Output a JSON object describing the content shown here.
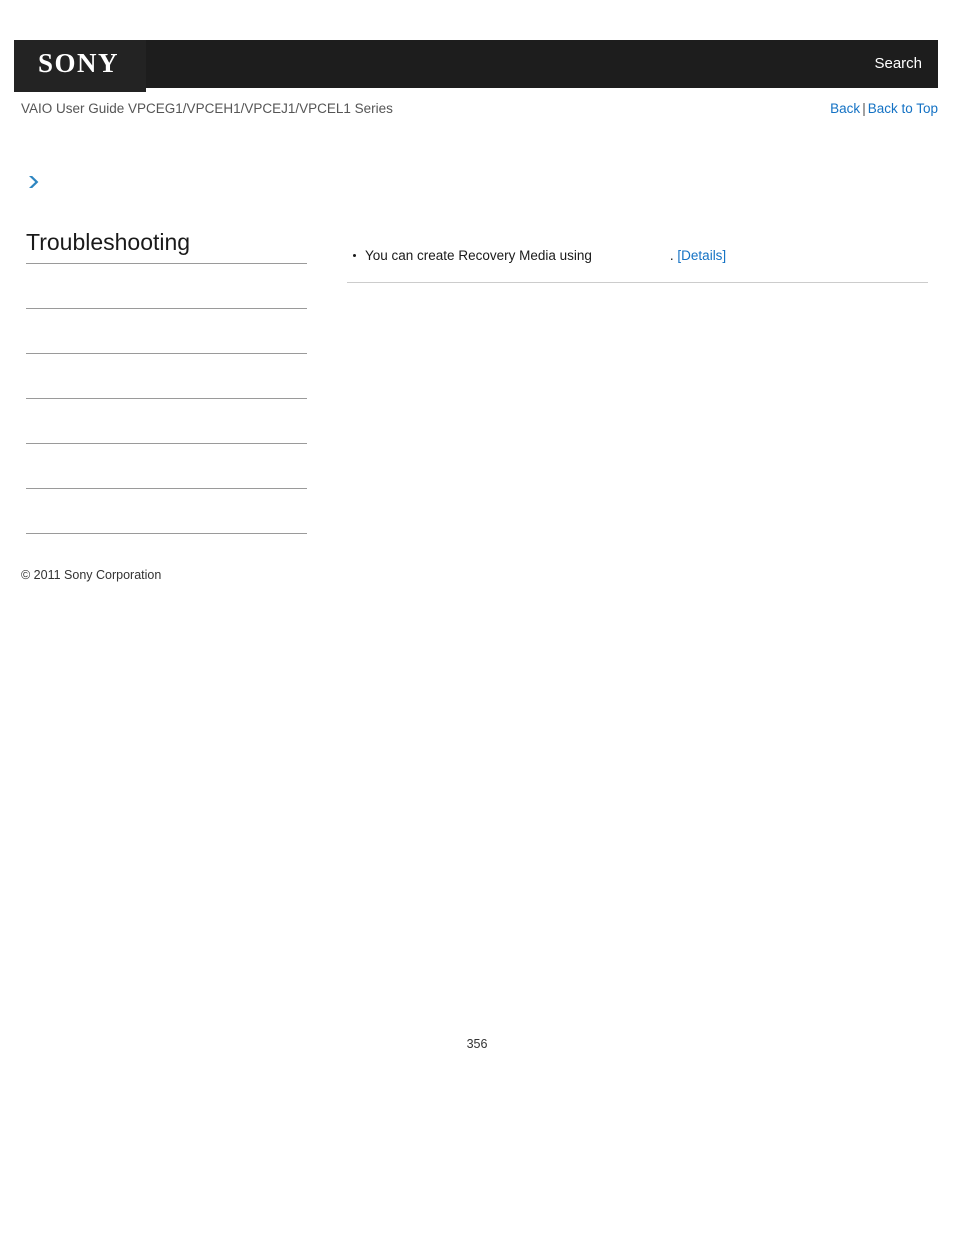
{
  "header": {
    "logo_text": "SONY",
    "search_label": "Search"
  },
  "sub_header": {
    "guide_title": "VAIO User Guide VPCEG1/VPCEH1/VPCEJ1/VPCEL1 Series",
    "back_label": "Back",
    "separator": "|",
    "back_to_top_label": "Back to Top"
  },
  "sidebar": {
    "title": "Troubleshooting",
    "items": [
      {
        "label": ""
      },
      {
        "label": ""
      },
      {
        "label": ""
      },
      {
        "label": ""
      },
      {
        "label": ""
      },
      {
        "label": ""
      }
    ]
  },
  "content": {
    "bullets": [
      {
        "text_before": "You can create Recovery Media using",
        "text_after": ".",
        "details_label": "[Details]"
      }
    ]
  },
  "footer": {
    "copyright": "© 2011 Sony Corporation",
    "page_number": "356"
  },
  "colors": {
    "header_bg": "#1d1d1d",
    "logo_bg": "#232323",
    "link_blue": "#1472c4",
    "arrow_blue": "#2e86c1",
    "rule_gray": "#9a9a9a",
    "content_rule": "#cccccc"
  }
}
